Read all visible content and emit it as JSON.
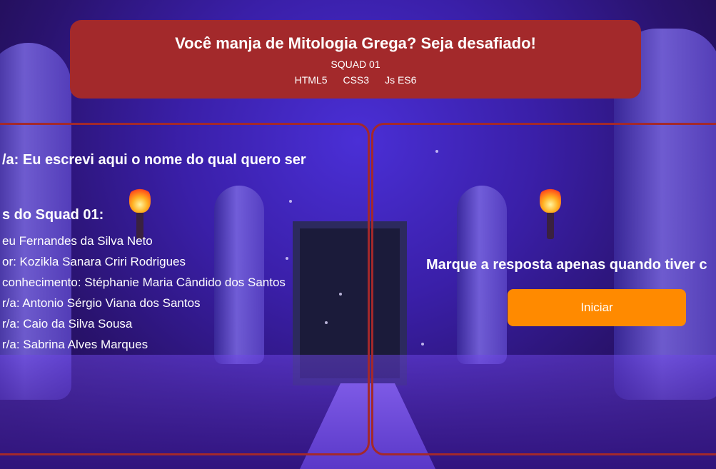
{
  "header": {
    "title": "Você manja de Mitologia Grega? Seja desafiado!",
    "squad": "SQUAD 01",
    "tech": [
      "HTML5",
      "CSS3",
      "Js ES6"
    ]
  },
  "left_panel": {
    "author_line": "/a: Eu escrevi aqui o nome do qual quero ser",
    "squad_heading": "s do Squad 01:",
    "members": [
      "eu Fernandes da Silva Neto",
      "or: Kozikla Sanara Criri Rodrigues",
      " conhecimento: Stéphanie Maria Cândido dos Santos",
      "r/a: Antonio Sérgio Viana dos Santos",
      "r/a: Caio da Silva Sousa",
      "r/a: Sabrina Alves Marques"
    ]
  },
  "right_panel": {
    "hint": "Marque a resposta apenas quando tiver c",
    "start_button": "Iniciar"
  },
  "colors": {
    "header_bg": "#a3292b",
    "panel_border": "#a3292b",
    "button_bg": "#ff8a00"
  },
  "icons": [
    "torch-icon"
  ]
}
